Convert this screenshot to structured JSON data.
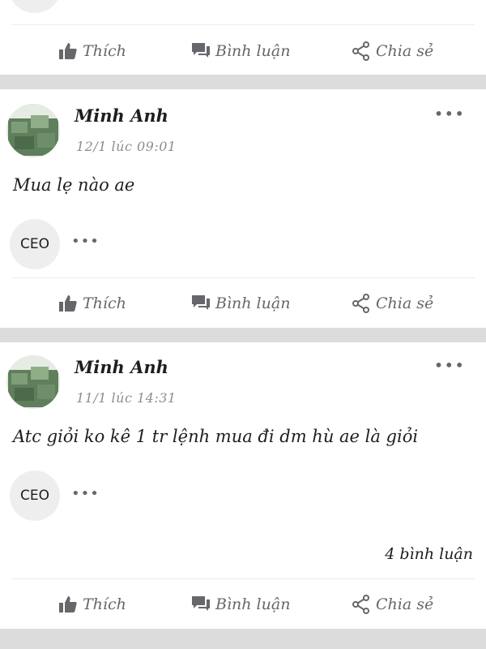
{
  "actions": {
    "like": "Thích",
    "comment": "Bình luận",
    "share": "Chia sẻ"
  },
  "posts": [
    {
      "author": "Minh Anh",
      "time": "12/1 lúc 09:01",
      "content": "Mua lẹ nào ae",
      "reactor": "CEO",
      "comment_count": ""
    },
    {
      "author": "Minh Anh",
      "time": "11/1 lúc 14:31",
      "content": "Atc giỏi ko kê 1 tr lệnh mua đi dm hù ae là giỏi",
      "reactor": "CEO",
      "comment_count": "4 bình luận"
    }
  ],
  "icons": [
    "like-icon",
    "comment-icon",
    "share-icon",
    "more-options-icon"
  ],
  "colors": {
    "icon": "#65676b",
    "separator": "#dcdcdc",
    "meta": "#8a8d91"
  }
}
